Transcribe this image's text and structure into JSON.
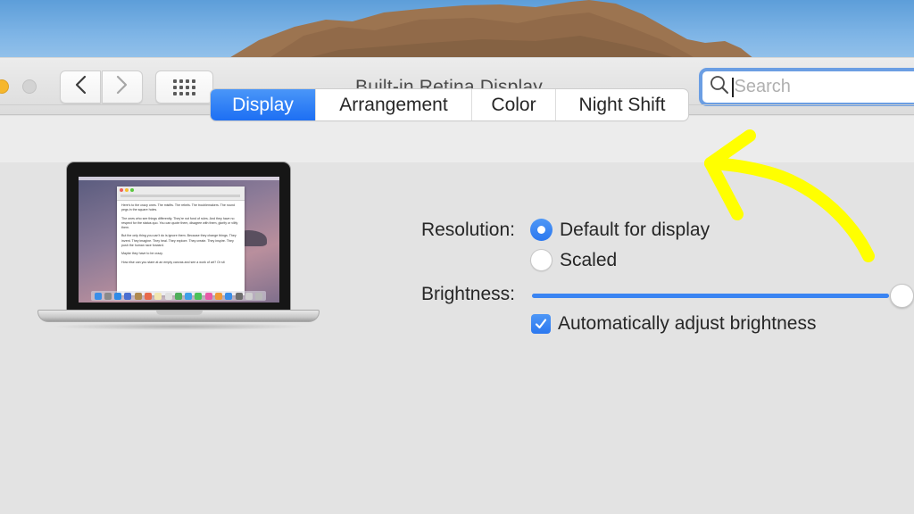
{
  "window": {
    "title": "Built-in Retina Display"
  },
  "toolbar": {
    "back_icon": "chevron-left-icon",
    "forward_icon": "chevron-right-icon",
    "show_all_icon": "grid-icon",
    "search": {
      "value": "",
      "placeholder": "Search",
      "icon": "search-icon"
    }
  },
  "tabs": [
    {
      "label": "Display",
      "active": true
    },
    {
      "label": "Arrangement",
      "active": false
    },
    {
      "label": "Color",
      "active": false
    },
    {
      "label": "Night Shift",
      "active": false
    }
  ],
  "display": {
    "resolution_label": "Resolution:",
    "resolution_options": [
      {
        "label": "Default for display",
        "selected": true
      },
      {
        "label": "Scaled",
        "selected": false
      }
    ],
    "brightness_label": "Brightness:",
    "brightness_level": 1.0,
    "auto_brightness": {
      "label": "Automatically adjust brightness",
      "checked": true
    }
  },
  "laptop_preview": {
    "document_paragraphs": [
      "Here's to the crazy ones. The misfits. The rebels. The troublemakers. The round pegs in the square holes.",
      "The ones who see things differently. They're not fond of rules. And they have no respect for the status quo. You can quote them, disagree with them, glorify or vilify them.",
      "But the only thing you can't do is ignore them. Because they change things. They invent. They imagine. They heal. They explore. They create. They inspire. They push the human race forward.",
      "Maybe they have to be crazy.",
      "How else can you stare at an empty canvas and see a work of art? Or sit"
    ]
  },
  "colors": {
    "accent": "#2c78ef",
    "search_focus_ring": "#6b9ee3",
    "annotation": "#ffff00",
    "traffic_minimize": "#f6b72c"
  }
}
